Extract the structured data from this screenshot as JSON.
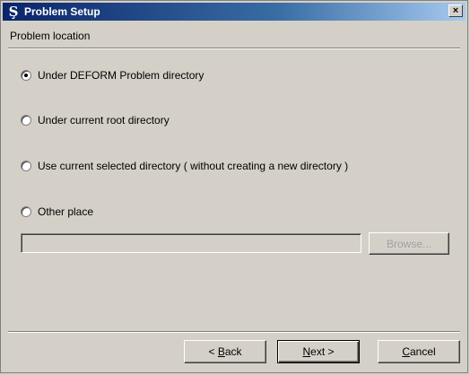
{
  "window": {
    "title": "Problem Setup",
    "close_glyph": "×"
  },
  "section": {
    "label": "Problem location"
  },
  "options": [
    {
      "label": "Under DEFORM Problem directory",
      "checked": true
    },
    {
      "label": "Under current root directory",
      "checked": false
    },
    {
      "label": "Use current selected directory ( without creating a new directory )",
      "checked": false
    },
    {
      "label": "Other place",
      "checked": false
    }
  ],
  "path": {
    "value": "",
    "disabled": true
  },
  "buttons": {
    "browse": "Browse...",
    "back_prefix": "< ",
    "back_accel": "B",
    "back_rest": "ack",
    "next_prefix": "",
    "next_accel": "N",
    "next_rest": "ext >",
    "cancel_prefix": "",
    "cancel_accel": "C",
    "cancel_rest": "ancel"
  },
  "colors": {
    "title_start": "#0a246a",
    "title_end": "#a6caf0",
    "face": "#d4d0c8"
  },
  "icons": {
    "app": "deform-app-icon",
    "close": "close-icon"
  }
}
